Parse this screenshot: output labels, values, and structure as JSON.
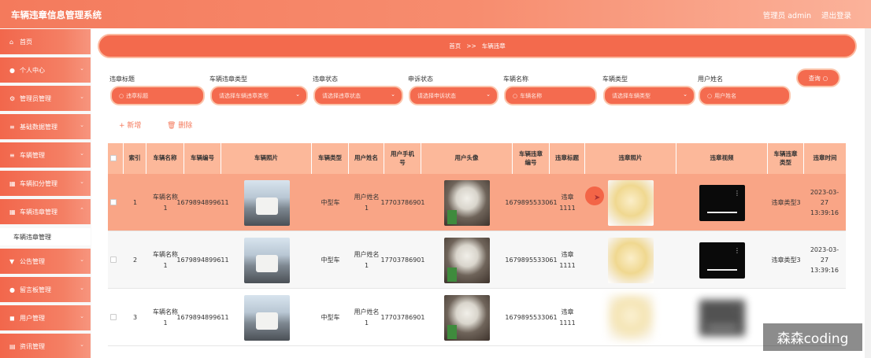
{
  "header": {
    "app_title": "车辆违章信息管理系统",
    "user_label": "管理员 admin",
    "logout": "退出登录"
  },
  "sidebar": {
    "items": [
      {
        "label": "首页",
        "icon": "home-icon"
      },
      {
        "label": "个人中心",
        "icon": "user-icon"
      },
      {
        "label": "管理员管理",
        "icon": "admin-icon"
      },
      {
        "label": "基础数据管理",
        "icon": "list-icon"
      },
      {
        "label": "车辆管理",
        "icon": "list-icon"
      },
      {
        "label": "车辆扣分管理",
        "icon": "grid-icon"
      },
      {
        "label": "车辆违章管理",
        "icon": "grid-icon"
      },
      {
        "label": "公告管理",
        "icon": "notice-icon"
      },
      {
        "label": "留言板管理",
        "icon": "user-icon"
      },
      {
        "label": "用户管理",
        "icon": "users-icon"
      },
      {
        "label": "资讯管理",
        "icon": "news-icon"
      }
    ],
    "active_sub": "车辆违章管理"
  },
  "breadcrumb": {
    "home": "首页",
    "sep": ">>",
    "current": "车辆违章"
  },
  "filters": [
    {
      "label": "违章标题",
      "placeholder": "违章标题",
      "type": "input"
    },
    {
      "label": "车辆违章类型",
      "placeholder": "请选择车辆违章类型",
      "type": "select"
    },
    {
      "label": "违章状态",
      "placeholder": "请选择违章状态",
      "type": "select"
    },
    {
      "label": "申诉状态",
      "placeholder": "请选择申诉状态",
      "type": "select"
    },
    {
      "label": "车辆名称",
      "placeholder": "车辆名称",
      "type": "input"
    },
    {
      "label": "车辆类型",
      "placeholder": "请选择车辆类型",
      "type": "select"
    },
    {
      "label": "用户姓名",
      "placeholder": "用户姓名",
      "type": "input"
    }
  ],
  "search_button": "查询",
  "actions": {
    "add": "新增",
    "delete": "删除"
  },
  "table": {
    "columns": [
      "索引",
      "车辆名称",
      "车辆编号",
      "车辆照片",
      "车辆类型",
      "用户姓名",
      "用户手机号",
      "用户头像",
      "车辆违章编号",
      "违章标题",
      "违章照片",
      "违章视频",
      "车辆违章类型",
      "违章时间"
    ],
    "rows": [
      {
        "index": "1",
        "vehicle_name": "车辆名称1",
        "vehicle_no": "1679894899611",
        "vehicle_type": "中型车",
        "user_name": "用户姓名1",
        "phone": "17703786901",
        "violation_no": "1679895533061",
        "violation_title": "违章1111",
        "violation_type": "违章类型3",
        "violation_time": "2023-03-27 13:39:16"
      },
      {
        "index": "2",
        "vehicle_name": "车辆名称1",
        "vehicle_no": "1679894899611",
        "vehicle_type": "中型车",
        "user_name": "用户姓名1",
        "phone": "17703786901",
        "violation_no": "1679895533061",
        "violation_title": "违章1111",
        "violation_type": "违章类型3",
        "violation_time": "2023-03-27 13:39:16"
      },
      {
        "index": "3",
        "vehicle_name": "车辆名称1",
        "vehicle_no": "1679894899611",
        "vehicle_type": "中型车",
        "user_name": "用户姓名1",
        "phone": "17703786901",
        "violation_no": "1679895533061",
        "violation_title": "违章1111",
        "violation_type": "",
        "violation_time": ""
      }
    ]
  },
  "watermark": "森森coding",
  "colors": {
    "accent": "#f46b4f",
    "accent_light": "#fcb89a",
    "highlight_row": "#f9a586"
  }
}
